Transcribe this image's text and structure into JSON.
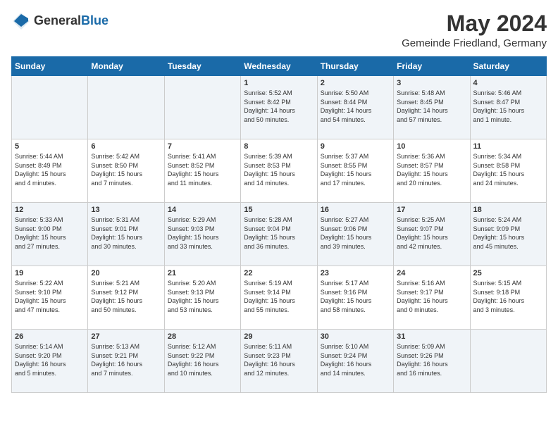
{
  "header": {
    "logo_general": "General",
    "logo_blue": "Blue",
    "month_year": "May 2024",
    "location": "Gemeinde Friedland, Germany"
  },
  "days_of_week": [
    "Sunday",
    "Monday",
    "Tuesday",
    "Wednesday",
    "Thursday",
    "Friday",
    "Saturday"
  ],
  "weeks": [
    [
      {
        "day": "",
        "info": ""
      },
      {
        "day": "",
        "info": ""
      },
      {
        "day": "",
        "info": ""
      },
      {
        "day": "1",
        "info": "Sunrise: 5:52 AM\nSunset: 8:42 PM\nDaylight: 14 hours\nand 50 minutes."
      },
      {
        "day": "2",
        "info": "Sunrise: 5:50 AM\nSunset: 8:44 PM\nDaylight: 14 hours\nand 54 minutes."
      },
      {
        "day": "3",
        "info": "Sunrise: 5:48 AM\nSunset: 8:45 PM\nDaylight: 14 hours\nand 57 minutes."
      },
      {
        "day": "4",
        "info": "Sunrise: 5:46 AM\nSunset: 8:47 PM\nDaylight: 15 hours\nand 1 minute."
      }
    ],
    [
      {
        "day": "5",
        "info": "Sunrise: 5:44 AM\nSunset: 8:49 PM\nDaylight: 15 hours\nand 4 minutes."
      },
      {
        "day": "6",
        "info": "Sunrise: 5:42 AM\nSunset: 8:50 PM\nDaylight: 15 hours\nand 7 minutes."
      },
      {
        "day": "7",
        "info": "Sunrise: 5:41 AM\nSunset: 8:52 PM\nDaylight: 15 hours\nand 11 minutes."
      },
      {
        "day": "8",
        "info": "Sunrise: 5:39 AM\nSunset: 8:53 PM\nDaylight: 15 hours\nand 14 minutes."
      },
      {
        "day": "9",
        "info": "Sunrise: 5:37 AM\nSunset: 8:55 PM\nDaylight: 15 hours\nand 17 minutes."
      },
      {
        "day": "10",
        "info": "Sunrise: 5:36 AM\nSunset: 8:57 PM\nDaylight: 15 hours\nand 20 minutes."
      },
      {
        "day": "11",
        "info": "Sunrise: 5:34 AM\nSunset: 8:58 PM\nDaylight: 15 hours\nand 24 minutes."
      }
    ],
    [
      {
        "day": "12",
        "info": "Sunrise: 5:33 AM\nSunset: 9:00 PM\nDaylight: 15 hours\nand 27 minutes."
      },
      {
        "day": "13",
        "info": "Sunrise: 5:31 AM\nSunset: 9:01 PM\nDaylight: 15 hours\nand 30 minutes."
      },
      {
        "day": "14",
        "info": "Sunrise: 5:29 AM\nSunset: 9:03 PM\nDaylight: 15 hours\nand 33 minutes."
      },
      {
        "day": "15",
        "info": "Sunrise: 5:28 AM\nSunset: 9:04 PM\nDaylight: 15 hours\nand 36 minutes."
      },
      {
        "day": "16",
        "info": "Sunrise: 5:27 AM\nSunset: 9:06 PM\nDaylight: 15 hours\nand 39 minutes."
      },
      {
        "day": "17",
        "info": "Sunrise: 5:25 AM\nSunset: 9:07 PM\nDaylight: 15 hours\nand 42 minutes."
      },
      {
        "day": "18",
        "info": "Sunrise: 5:24 AM\nSunset: 9:09 PM\nDaylight: 15 hours\nand 45 minutes."
      }
    ],
    [
      {
        "day": "19",
        "info": "Sunrise: 5:22 AM\nSunset: 9:10 PM\nDaylight: 15 hours\nand 47 minutes."
      },
      {
        "day": "20",
        "info": "Sunrise: 5:21 AM\nSunset: 9:12 PM\nDaylight: 15 hours\nand 50 minutes."
      },
      {
        "day": "21",
        "info": "Sunrise: 5:20 AM\nSunset: 9:13 PM\nDaylight: 15 hours\nand 53 minutes."
      },
      {
        "day": "22",
        "info": "Sunrise: 5:19 AM\nSunset: 9:14 PM\nDaylight: 15 hours\nand 55 minutes."
      },
      {
        "day": "23",
        "info": "Sunrise: 5:17 AM\nSunset: 9:16 PM\nDaylight: 15 hours\nand 58 minutes."
      },
      {
        "day": "24",
        "info": "Sunrise: 5:16 AM\nSunset: 9:17 PM\nDaylight: 16 hours\nand 0 minutes."
      },
      {
        "day": "25",
        "info": "Sunrise: 5:15 AM\nSunset: 9:18 PM\nDaylight: 16 hours\nand 3 minutes."
      }
    ],
    [
      {
        "day": "26",
        "info": "Sunrise: 5:14 AM\nSunset: 9:20 PM\nDaylight: 16 hours\nand 5 minutes."
      },
      {
        "day": "27",
        "info": "Sunrise: 5:13 AM\nSunset: 9:21 PM\nDaylight: 16 hours\nand 7 minutes."
      },
      {
        "day": "28",
        "info": "Sunrise: 5:12 AM\nSunset: 9:22 PM\nDaylight: 16 hours\nand 10 minutes."
      },
      {
        "day": "29",
        "info": "Sunrise: 5:11 AM\nSunset: 9:23 PM\nDaylight: 16 hours\nand 12 minutes."
      },
      {
        "day": "30",
        "info": "Sunrise: 5:10 AM\nSunset: 9:24 PM\nDaylight: 16 hours\nand 14 minutes."
      },
      {
        "day": "31",
        "info": "Sunrise: 5:09 AM\nSunset: 9:26 PM\nDaylight: 16 hours\nand 16 minutes."
      },
      {
        "day": "",
        "info": ""
      }
    ]
  ]
}
